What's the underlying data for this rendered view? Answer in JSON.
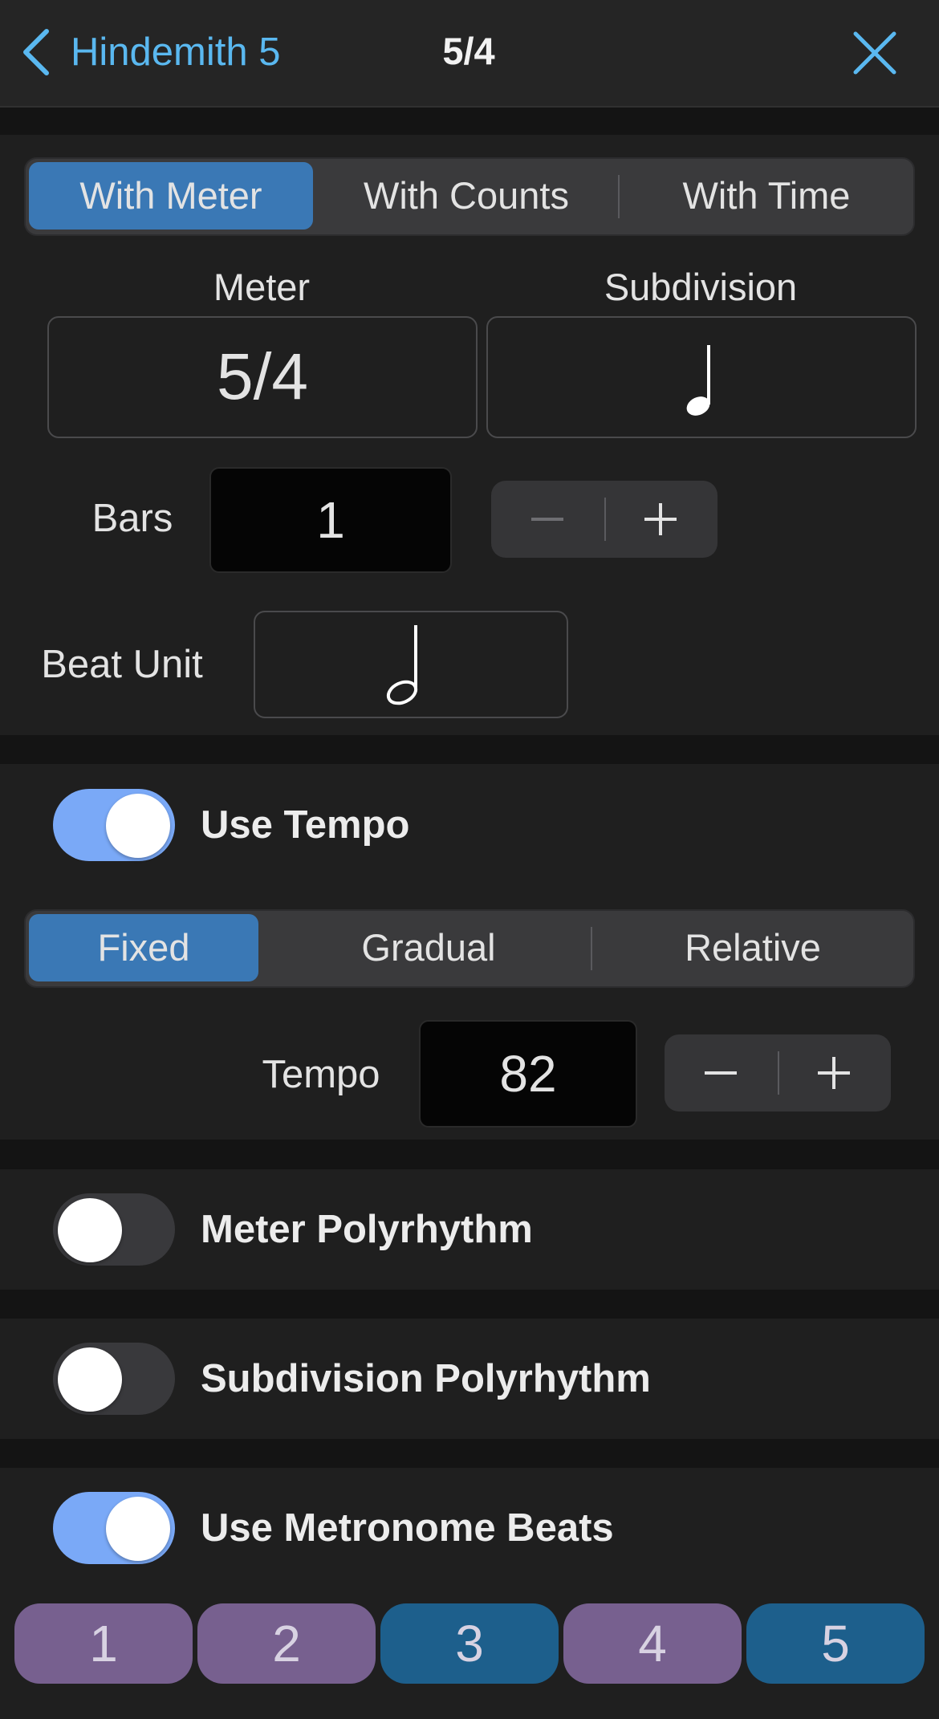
{
  "nav": {
    "back_label": "Hindemith 5",
    "title": "5/4",
    "back_icon": "chevron-left-icon",
    "close_icon": "close-icon",
    "accent_color": "#5ab8f0"
  },
  "mode_tabs": {
    "items": [
      "With Meter",
      "With Counts",
      "With Time"
    ],
    "selected": "With Meter"
  },
  "meter": {
    "label": "Meter",
    "value": "5/4"
  },
  "subdivision": {
    "label": "Subdivision",
    "value_icon": "quarter-note-icon"
  },
  "bars": {
    "label": "Bars",
    "value": "1",
    "minus": "−",
    "plus": "+"
  },
  "beat_unit": {
    "label": "Beat Unit",
    "value_icon": "half-note-icon"
  },
  "tempo_toggle": {
    "label": "Use Tempo",
    "on": true
  },
  "tempo_tabs": {
    "items": [
      "Fixed",
      "Gradual",
      "Relative"
    ],
    "selected": "Fixed"
  },
  "tempo": {
    "label": "Tempo",
    "value": "82",
    "minus": "−",
    "plus": "+"
  },
  "meter_polyrhythm": {
    "label": "Meter Polyrhythm",
    "on": false
  },
  "subdivision_polyrhythm": {
    "label": "Subdivision Polyrhythm",
    "on": false
  },
  "metronome_beats": {
    "label": "Use Metronome Beats",
    "on": true,
    "beats": [
      {
        "label": "1",
        "accent": false
      },
      {
        "label": "2",
        "accent": false
      },
      {
        "label": "3",
        "accent": true
      },
      {
        "label": "4",
        "accent": false
      },
      {
        "label": "5",
        "accent": true
      }
    ],
    "colors": {
      "normal": "#77608f",
      "accent": "#1d5f8c"
    }
  }
}
